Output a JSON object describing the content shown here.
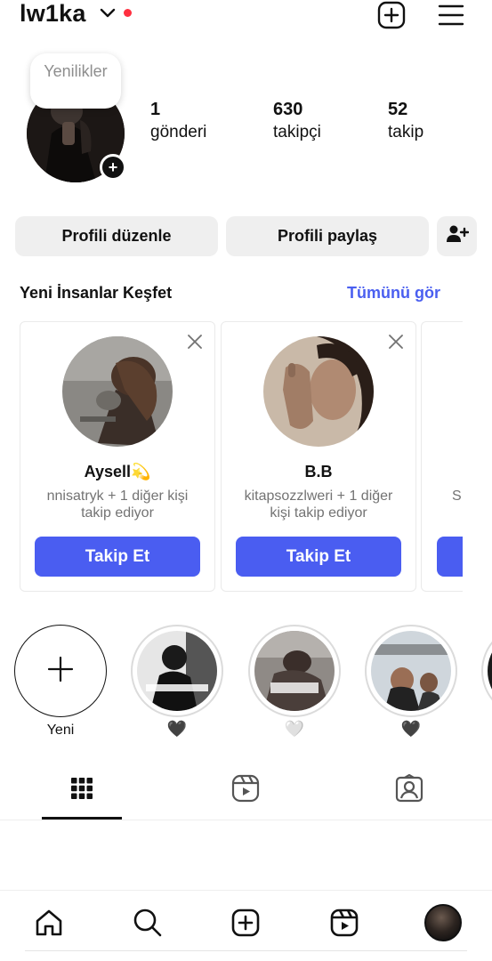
{
  "header": {
    "username": "lw1ka",
    "icons": [
      "chevron-down-icon",
      "new-post-icon",
      "menu-icon"
    ],
    "notification_dot_color": "#ff3040"
  },
  "profile": {
    "note": "Yenilikler",
    "stats": [
      {
        "value": "1",
        "label": "gönderi"
      },
      {
        "value": "630",
        "label": "takipçi"
      },
      {
        "value": "52",
        "label": "takip"
      }
    ]
  },
  "actions": {
    "edit_label": "Profili düzenle",
    "share_label": "Profili paylaş"
  },
  "discover": {
    "title": "Yeni İnsanlar Keşfet",
    "see_all": "Tümünü gör",
    "cards": [
      {
        "name": "Aysell💫",
        "subtitle": "nnisatryk + 1 diğer kişi takip ediyor",
        "follow": "Takip Et"
      },
      {
        "name": "B.B",
        "subtitle": "kitapsozzlweri + 1 diğer kişi takip ediyor",
        "follow": "Takip Et"
      },
      {
        "name": "",
        "subtitle": "S",
        "follow": ""
      }
    ]
  },
  "highlights": {
    "new_label": "Yeni",
    "items": [
      {
        "heart": "🖤"
      },
      {
        "heart": "🤍"
      },
      {
        "heart": "🖤"
      }
    ]
  },
  "colors": {
    "accent": "#4a5df1",
    "link": "#4a5ff0",
    "button_bg": "#efefef"
  }
}
